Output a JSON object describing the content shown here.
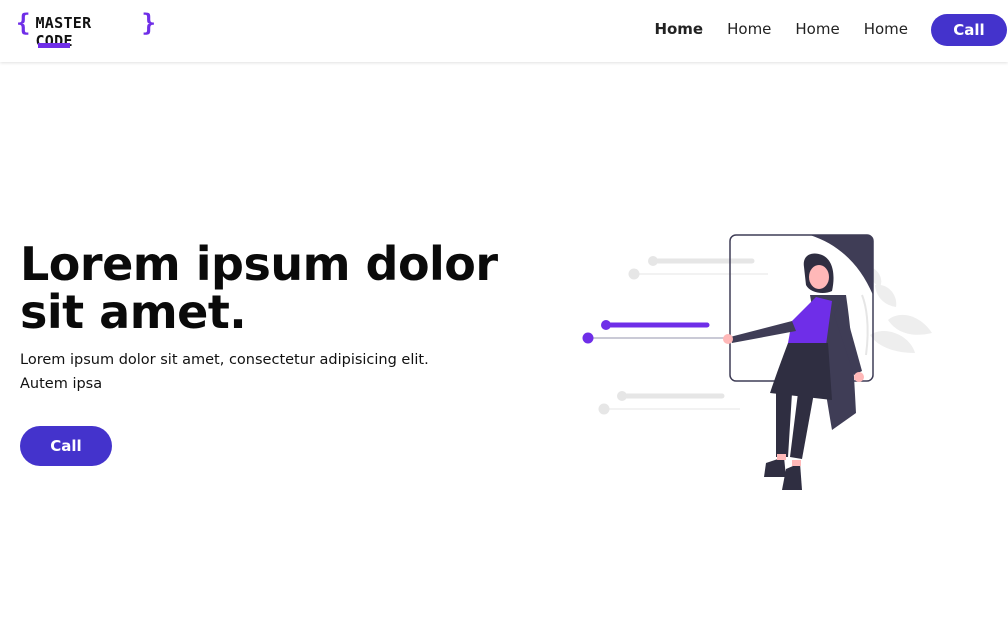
{
  "navbar": {
    "logo": {
      "brace_open": "{",
      "text": "MASTER CODE",
      "brace_close": "}"
    },
    "links": [
      {
        "label": "Home",
        "active": true
      },
      {
        "label": "Home",
        "active": false
      },
      {
        "label": "Home",
        "active": false
      },
      {
        "label": "Home",
        "active": false
      }
    ],
    "cta_label": "Call"
  },
  "hero": {
    "title": "Lorem ipsum dolor sit amet.",
    "subtitle": "Lorem ipsum dolor sit amet, consectetur adipisicing elit. Autem ipsa",
    "cta_label": "Call"
  },
  "colors": {
    "accent": "#4433cc",
    "brand_purple": "#6f2ee8",
    "figure_dark": "#3f3d56",
    "line_gray": "#e6e6e6"
  }
}
